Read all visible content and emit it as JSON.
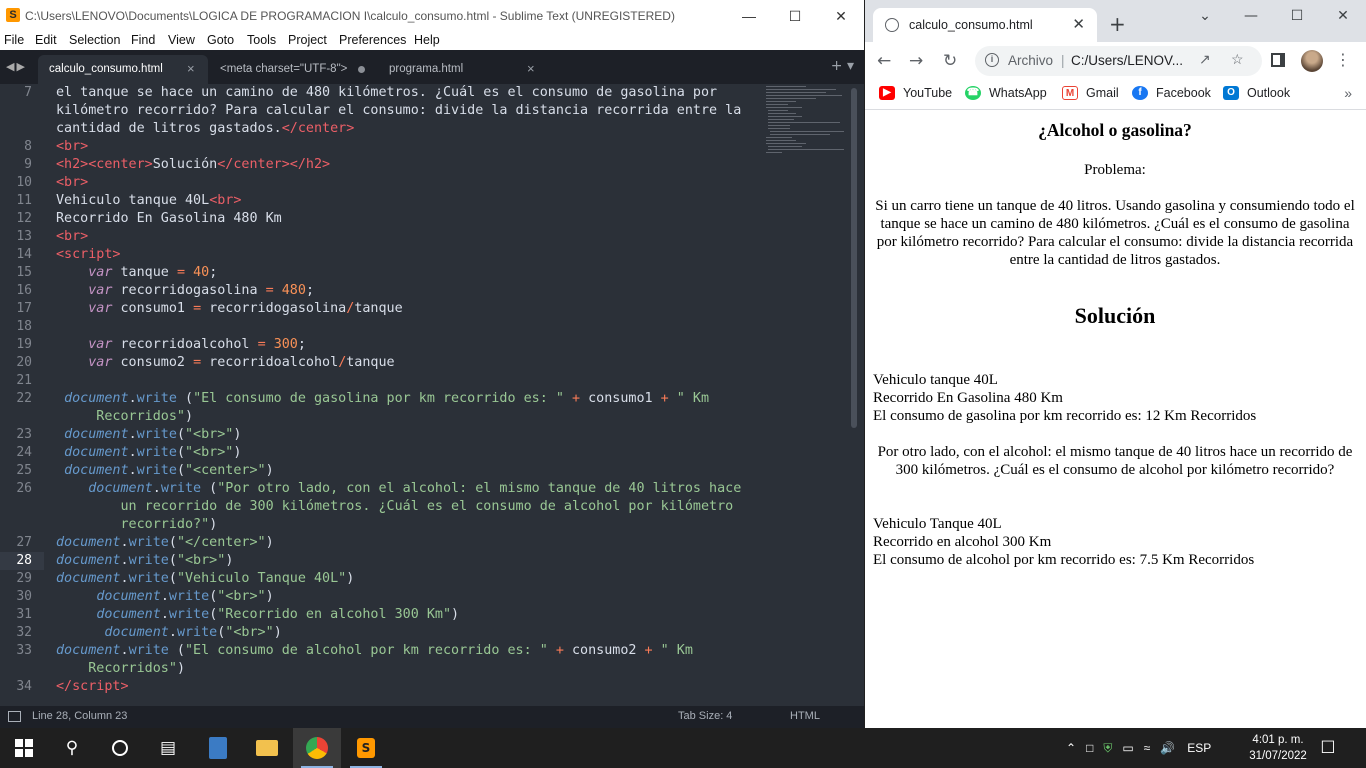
{
  "sublime": {
    "title": "C:\\Users\\LENOVO\\Documents\\LOGICA DE PROGRAMACION I\\calculo_consumo.html - Sublime Text (UNREGISTERED)",
    "menu": [
      "File",
      "Edit",
      "Selection",
      "Find",
      "View",
      "Goto",
      "Tools",
      "Project",
      "Preferences",
      "Help"
    ],
    "tabs": [
      {
        "label": "calculo_consumo.html",
        "active": true
      },
      {
        "label": "<meta charset=\"UTF-8\">",
        "dirty": true
      },
      {
        "label": "programa.html"
      }
    ],
    "line_numbers": [
      "7",
      "8",
      "9",
      "10",
      "11",
      "12",
      "13",
      "14",
      "15",
      "16",
      "17",
      "18",
      "19",
      "20",
      "21",
      "22",
      "23",
      "24",
      "25",
      "26",
      "27",
      "28",
      "29",
      "30",
      "31",
      "32",
      "33",
      "34"
    ],
    "current_line": "28",
    "status": {
      "position": "Line 28, Column 23",
      "tab_size": "Tab Size: 4",
      "syntax": "HTML"
    }
  },
  "chrome": {
    "tab_title": "calculo_consumo.html",
    "address": {
      "scheme_label": "Archivo",
      "url": "C:/Users/LENOV..."
    },
    "bookmarks": [
      {
        "label": "YouTube",
        "icon": "youtube-icon",
        "color": "#ff0000"
      },
      {
        "label": "WhatsApp",
        "icon": "whatsapp-icon",
        "color": "#25d366"
      },
      {
        "label": "Gmail",
        "icon": "gmail-icon",
        "color": "#ea4335"
      },
      {
        "label": "Facebook",
        "icon": "facebook-icon",
        "color": "#1877f2"
      },
      {
        "label": "Outlook",
        "icon": "outlook-icon",
        "color": "#0078d4"
      }
    ],
    "page": {
      "heading": "¿Alcohol o gasolina?",
      "problem_label": "Problema:",
      "problem_text": "Si un carro tiene un tanque de 40 litros. Usando gasolina y consumiendo todo el tanque se hace un camino de 480 kilómetros. ¿Cuál es el consumo de gasolina por kilómetro recorrido? Para calcular el consumo: divide la distancia recorrida entre la cantidad de litros gastados.",
      "solution_heading": "Solución",
      "gas_vehicle": "Vehiculo tanque 40L",
      "gas_distance": "Recorrido En Gasolina 480 Km",
      "gas_result": "El consumo de gasolina por km recorrido es: 12 Km Recorridos",
      "alcohol_text": "Por otro lado, con el alcohol: el mismo tanque de 40 litros hace un recorrido de 300 kilómetros. ¿Cuál es el consumo de alcohol por kilómetro recorrido?",
      "alc_vehicle": "Vehiculo Tanque 40L",
      "alc_distance": "Recorrido en alcohol 300 Km",
      "alc_result": "El consumo de alcohol por km recorrido es: 7.5 Km Recorridos"
    }
  },
  "taskbar": {
    "language": "ESP",
    "time": "4:01 p. m.",
    "date": "31/07/2022"
  }
}
